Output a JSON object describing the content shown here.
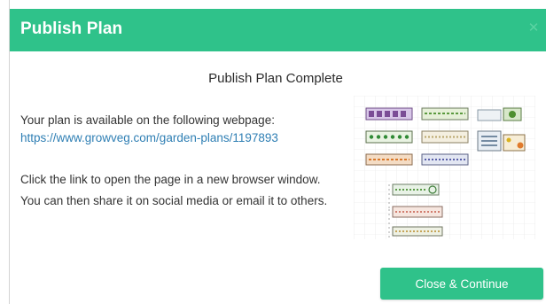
{
  "dialog": {
    "title": "Publish Plan",
    "close_icon": "close-icon",
    "subtitle": "Publish Plan Complete",
    "available_text": "Your plan is available on the following webpage:",
    "plan_url": "https://www.growveg.com/garden-plans/1197893",
    "instructions": "Click the link to open the page in a new browser window. You can then share it on social media or email it to others.",
    "continue_label": "Close & Continue"
  },
  "colors": {
    "accent": "#2fc28a",
    "link": "#2f7fb4",
    "text": "#333333"
  }
}
